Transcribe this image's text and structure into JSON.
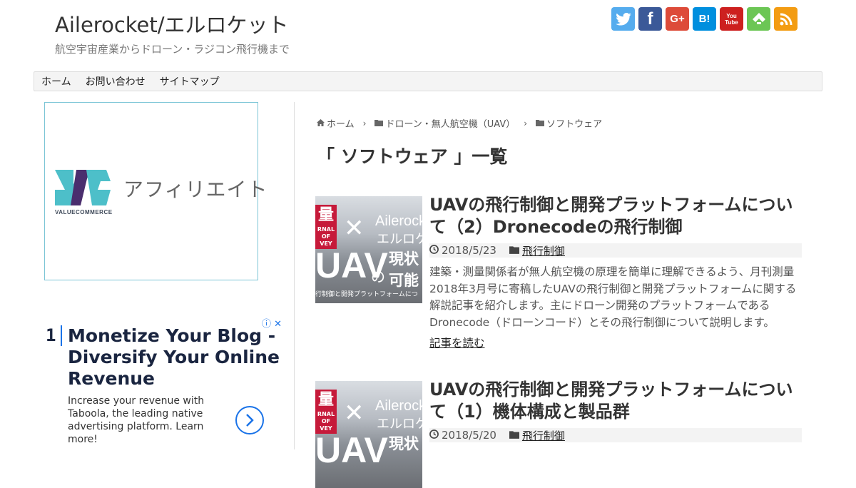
{
  "header": {
    "site_title": "Ailerocket/エルロケット",
    "site_description": "航空宇宙産業からドローン・ラジコン飛行機まで"
  },
  "social": [
    {
      "name": "twitter-icon",
      "glyph": "🐦",
      "color": "#55acee"
    },
    {
      "name": "facebook-icon",
      "glyph": "f",
      "color": "#3b5998"
    },
    {
      "name": "google-plus-icon",
      "glyph": "G+",
      "color": "#dd4b39"
    },
    {
      "name": "hatena-bookmark-icon",
      "glyph": "B!",
      "color": "#008fde"
    },
    {
      "name": "youtube-icon",
      "glyph": "You Tube",
      "color": "#cd201f"
    },
    {
      "name": "feedly-icon",
      "glyph": "f",
      "color": "#6cc655"
    },
    {
      "name": "rss-icon",
      "glyph": "◉",
      "color": "#f39c12"
    }
  ],
  "nav": {
    "items": [
      "ホーム",
      "お問い合わせ",
      "サイトマップ"
    ]
  },
  "sidebar": {
    "vc_ad": {
      "brand": "VALUECOMMERCE",
      "text": "アフィリエイト"
    },
    "taboola_ad": {
      "number": "1",
      "headline": "Monetize Your Blog - Diversify Your Online Revenue",
      "body": "Increase your revenue with Taboola, the leading native advertising platform. Learn more!"
    }
  },
  "breadcrumb": {
    "home": "ホーム",
    "category": "ドローン・無人航空機（UAV）",
    "current": "ソフトウェア"
  },
  "archive_title": "「 ソフトウェア 」一覧",
  "entries": [
    {
      "title": "UAVの飛行制御と開発プラットフォームについて（2）Dronecodeの飛行制御",
      "date": "2018/5/23",
      "category": "飛行制御",
      "snippet": "建築・測量関係者が無人航空機の原理を簡単に理解できるよう、月刊測量 2018年3月号に寄稿したUAVの飛行制御と開発プラットフォームに関する解説記事を紹介します。主にドローン開発のプラットフォームであるDronecode（ドローンコード）とその飛行制御について説明します。",
      "more": "記事を読む",
      "thumb": {
        "tag": "量",
        "tag_sub": "RNAL OF VEY",
        "brand_en": "Ailerocket",
        "brand_jp": "エルロケット",
        "big": "UAV",
        "no": "の",
        "line1": "現状",
        "line2": "可能",
        "sub": "行制御と開発プラットフォームにつ"
      }
    },
    {
      "title": "UAVの飛行制御と開発プラットフォームについて（1）機体構成と製品群",
      "date": "2018/5/20",
      "category": "飛行制御",
      "thumb": {
        "tag": "量",
        "tag_sub": "RNAL OF VEY",
        "brand_en": "Ailerocket",
        "brand_jp": "エルロケット",
        "big": "UAV",
        "line1": "現状"
      }
    }
  ]
}
